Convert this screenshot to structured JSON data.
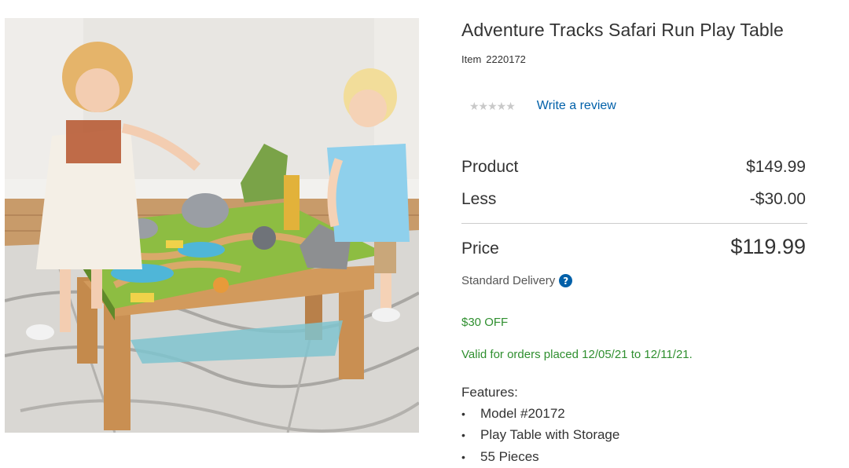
{
  "product": {
    "title": "Adventure Tracks Safari Run Play Table",
    "item_label": "Item",
    "item_number": "2220172",
    "stars": "★★★★★",
    "write_review": "Write a review"
  },
  "pricing": {
    "product_label": "Product",
    "product_value": "$149.99",
    "less_label": "Less",
    "less_value": "-$30.00",
    "price_label": "Price",
    "price_value": "$119.99"
  },
  "delivery": {
    "label": "Standard Delivery",
    "help_icon": "?"
  },
  "promo": {
    "discount": "$30 OFF",
    "validity": "Valid for orders placed 12/05/21 to 12/11/21."
  },
  "features": {
    "title": "Features:",
    "bullet": "•",
    "items": [
      "Model #20172",
      "Play Table with Storage",
      "55 Pieces"
    ]
  },
  "colors": {
    "link": "#0060a9",
    "promo_green": "#2f8f2f",
    "star_gray": "#c9c9c9"
  },
  "icons": {
    "help": "question-circle-icon",
    "rating": "star-icon"
  }
}
